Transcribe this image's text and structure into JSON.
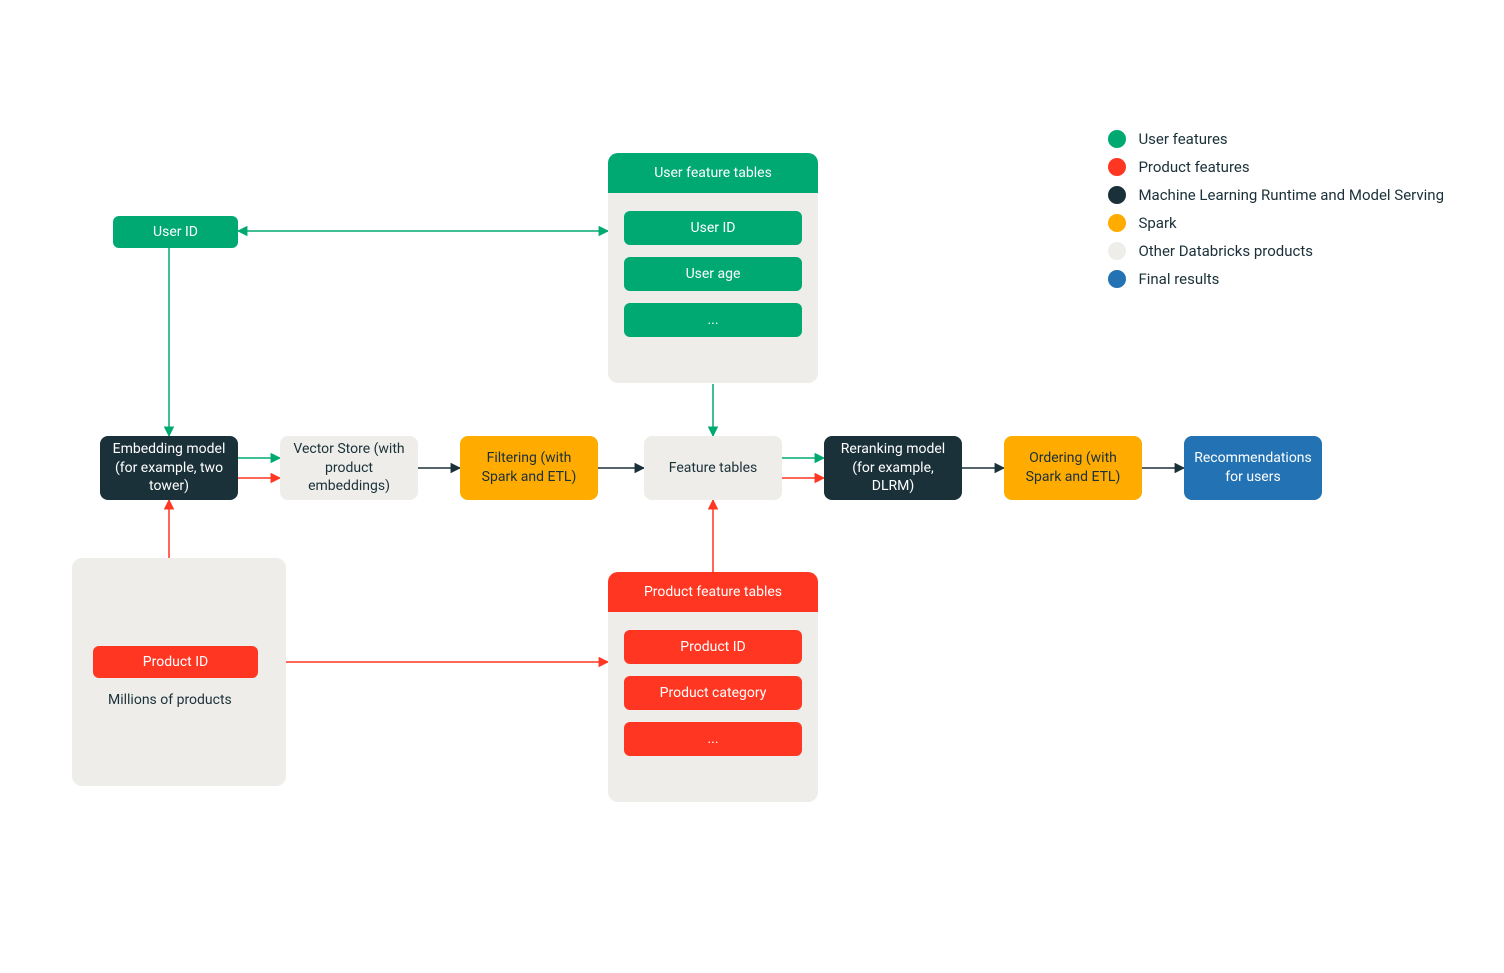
{
  "legend": {
    "user_features": "User features",
    "product_features": "Product features",
    "ml_runtime": "Machine Learning Runtime and Model Serving",
    "spark": "Spark",
    "other_products": "Other Databricks products",
    "final_results": "Final results"
  },
  "colors": {
    "green": "#00a972",
    "red": "#ff3621",
    "navy": "#1b3139",
    "amber": "#ffab00",
    "gray": "#eeede9",
    "blue": "#2272b4"
  },
  "nodes": {
    "user_id": "User ID",
    "product_id": "Product ID",
    "millions": "Millions of products",
    "embedding": "Embedding model (for example, two tower)",
    "vector_store": "Vector Store (with product embeddings)",
    "filtering": "Filtering (with Spark and ETL)",
    "feature_tables": "Feature tables",
    "reranking": "Reranking model (for example, DLRM)",
    "ordering": "Ordering (with Spark and ETL)",
    "recommendations": "Recommendations for users"
  },
  "user_feature_table": {
    "title": "User feature tables",
    "rows": [
      "User ID",
      "User age",
      "..."
    ]
  },
  "product_feature_table": {
    "title": "Product feature tables",
    "rows": [
      "Product ID",
      "Product category",
      "..."
    ]
  }
}
